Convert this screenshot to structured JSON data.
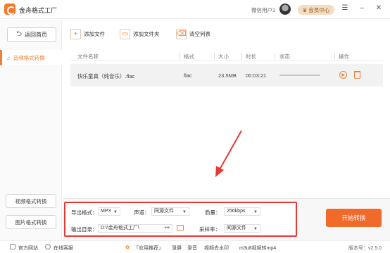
{
  "app": {
    "title": "金舟格式工厂"
  },
  "user": {
    "name": "微信用户1",
    "vip_label": "会员中心"
  },
  "sidebar": {
    "back_label": "返回首页",
    "active_item": "音频格式转换",
    "bottom_buttons": [
      "视频格式转换",
      "图片格式转换"
    ]
  },
  "toolbar": {
    "add_file": "添加文件",
    "add_folder": "添加文件夹",
    "clear_list": "清空列表"
  },
  "table": {
    "headers": [
      "文件名称",
      "格式",
      "大小",
      "时长",
      "状态",
      "操作"
    ],
    "rows": [
      {
        "name": "快乐童真（纯音乐）.flac",
        "format": "flac",
        "size": "23.5MB",
        "duration": "00:03:21",
        "progress": 0
      }
    ]
  },
  "settings": {
    "export_format_label": "导出格式：",
    "export_format_value": "MP3",
    "channel_label": "声道：",
    "channel_value": "同源文件",
    "quality_label": "质量：",
    "quality_value": "256kbps",
    "output_dir_label": "输出目录：",
    "output_dir_value": "D:\\\\金舟格式工厂\\",
    "output_dir_more": "•••",
    "sample_rate_label": "采样率：",
    "sample_rate_value": "同源文件"
  },
  "start_button": "开始转换",
  "statusbar": {
    "website": "官方网站",
    "support": "在线客服",
    "recommend": "「应用推荐」",
    "links": [
      "录屏",
      "录音",
      "视频去水印",
      "m3u8视频转mp4"
    ],
    "version": "版本号：v2.5.0"
  },
  "colors": {
    "accent": "#f08134",
    "highlight_border": "#e53935",
    "arrow": "#e53935"
  }
}
